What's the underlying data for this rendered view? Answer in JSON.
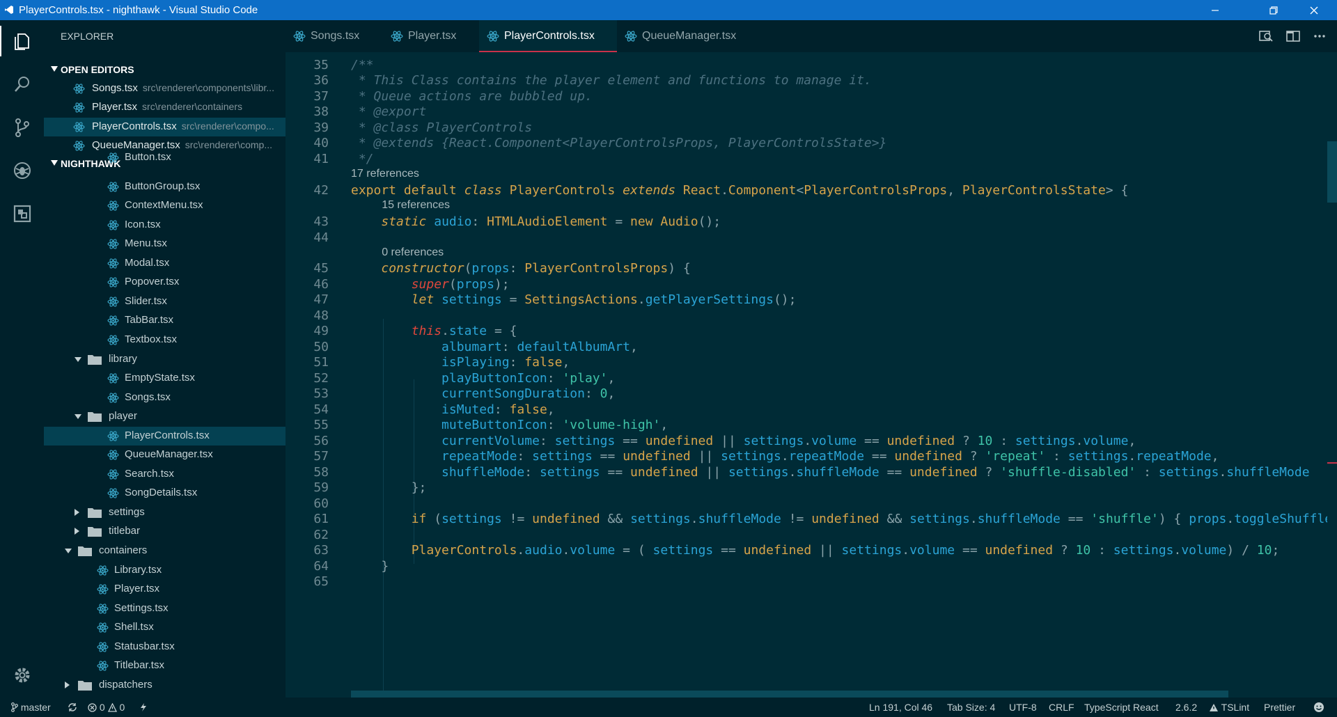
{
  "window": {
    "title": "PlayerControls.tsx - nighthawk - Visual Studio Code"
  },
  "sidebar": {
    "header": "EXPLORER",
    "open_editors_label": "OPEN EDITORS",
    "open_editors": [
      {
        "name": "Songs.tsx",
        "path": "src\\renderer\\components\\libr..."
      },
      {
        "name": "Player.tsx",
        "path": "src\\renderer\\containers"
      },
      {
        "name": "PlayerControls.tsx",
        "path": "src\\renderer\\compo..."
      },
      {
        "name": "QueueManager.tsx",
        "path": "src\\renderer\\comp..."
      }
    ],
    "project_label": "NIGHTHAWK",
    "tree": [
      "Button.tsx",
      "ButtonGroup.tsx",
      "ContextMenu.tsx",
      "Icon.tsx",
      "Menu.tsx",
      "Modal.tsx",
      "Popover.tsx",
      "Slider.tsx",
      "TabBar.tsx",
      "Textbox.tsx",
      "library",
      "EmptyState.tsx",
      "Songs.tsx",
      "player",
      "PlayerControls.tsx",
      "QueueManager.tsx",
      "Search.tsx",
      "SongDetails.tsx",
      "settings",
      "titlebar",
      "containers",
      "Library.tsx",
      "Player.tsx",
      "Settings.tsx",
      "Shell.tsx",
      "Statusbar.tsx",
      "Titlebar.tsx",
      "dispatchers"
    ]
  },
  "tabs": [
    "Songs.tsx",
    "Player.tsx",
    "PlayerControls.tsx",
    "QueueManager.tsx"
  ],
  "editor": {
    "lines": [
      {
        "n": "35",
        "t": "/**"
      },
      {
        "n": "36",
        "t": " * This Class contains the player element and functions to manage it."
      },
      {
        "n": "37",
        "t": " * Queue actions are bubbled up."
      },
      {
        "n": "38",
        "t": " * @export"
      },
      {
        "n": "39",
        "t": " * @class PlayerControls"
      },
      {
        "n": "40",
        "t": " * @extends {React.Component<PlayerControlsProps, PlayerControlsState>}"
      },
      {
        "n": "41",
        "t": " */"
      },
      {
        "lens": "17 references"
      },
      {
        "n": "42",
        "t": "export default class PlayerControls extends React.Component<PlayerControlsProps, PlayerControlsState> {"
      },
      {
        "lens": "15 references"
      },
      {
        "n": "43",
        "t": "    static audio: HTMLAudioElement = new Audio();"
      },
      {
        "n": "44",
        "t": ""
      },
      {
        "lens": "0 references"
      },
      {
        "n": "45",
        "t": "    constructor(props: PlayerControlsProps) {"
      },
      {
        "n": "46",
        "t": "        super(props);"
      },
      {
        "n": "47",
        "t": "        let settings = SettingsActions.getPlayerSettings();"
      },
      {
        "n": "48",
        "t": ""
      },
      {
        "n": "49",
        "t": "        this.state = {"
      },
      {
        "n": "50",
        "t": "            albumart: defaultAlbumArt,"
      },
      {
        "n": "51",
        "t": "            isPlaying: false,"
      },
      {
        "n": "52",
        "t": "            playButtonIcon: 'play',"
      },
      {
        "n": "53",
        "t": "            currentSongDuration: 0,"
      },
      {
        "n": "54",
        "t": "            isMuted: false,"
      },
      {
        "n": "55",
        "t": "            muteButtonIcon: 'volume-high',"
      },
      {
        "n": "56",
        "t": "            currentVolume: settings == undefined || settings.volume == undefined ? 10 : settings.volume,"
      },
      {
        "n": "57",
        "t": "            repeatMode: settings == undefined || settings.repeatMode == undefined ? 'repeat' : settings.repeatMode,"
      },
      {
        "n": "58",
        "t": "            shuffleMode: settings == undefined || settings.shuffleMode == undefined ? 'shuffle-disabled' : settings.shuffleMode"
      },
      {
        "n": "59",
        "t": "        };"
      },
      {
        "n": "60",
        "t": ""
      },
      {
        "n": "61",
        "t": "        if (settings != undefined && settings.shuffleMode != undefined && settings.shuffleMode == 'shuffle') { props.toggleShuffle"
      },
      {
        "n": "62",
        "t": ""
      },
      {
        "n": "63",
        "t": "        PlayerControls.audio.volume = ( settings == undefined || settings.volume == undefined ? 10 : settings.volume) / 10;"
      },
      {
        "n": "64",
        "t": "    }"
      },
      {
        "n": "65",
        "t": ""
      }
    ]
  },
  "statusbar": {
    "branch": "master",
    "errors": "0",
    "warnings": "0",
    "position": "Ln 191, Col 46",
    "tab_size": "Tab Size: 4",
    "encoding": "UTF-8",
    "eol": "CRLF",
    "language": "TypeScript React",
    "ts_version": "2.6.2",
    "tslint": "TSLint",
    "prettier": "Prettier"
  },
  "colors": {
    "titlebar": "#0d6ec7",
    "sidebar": "#00212b",
    "editor_bg": "#002b36",
    "tab_active_border": "#c9324a"
  }
}
